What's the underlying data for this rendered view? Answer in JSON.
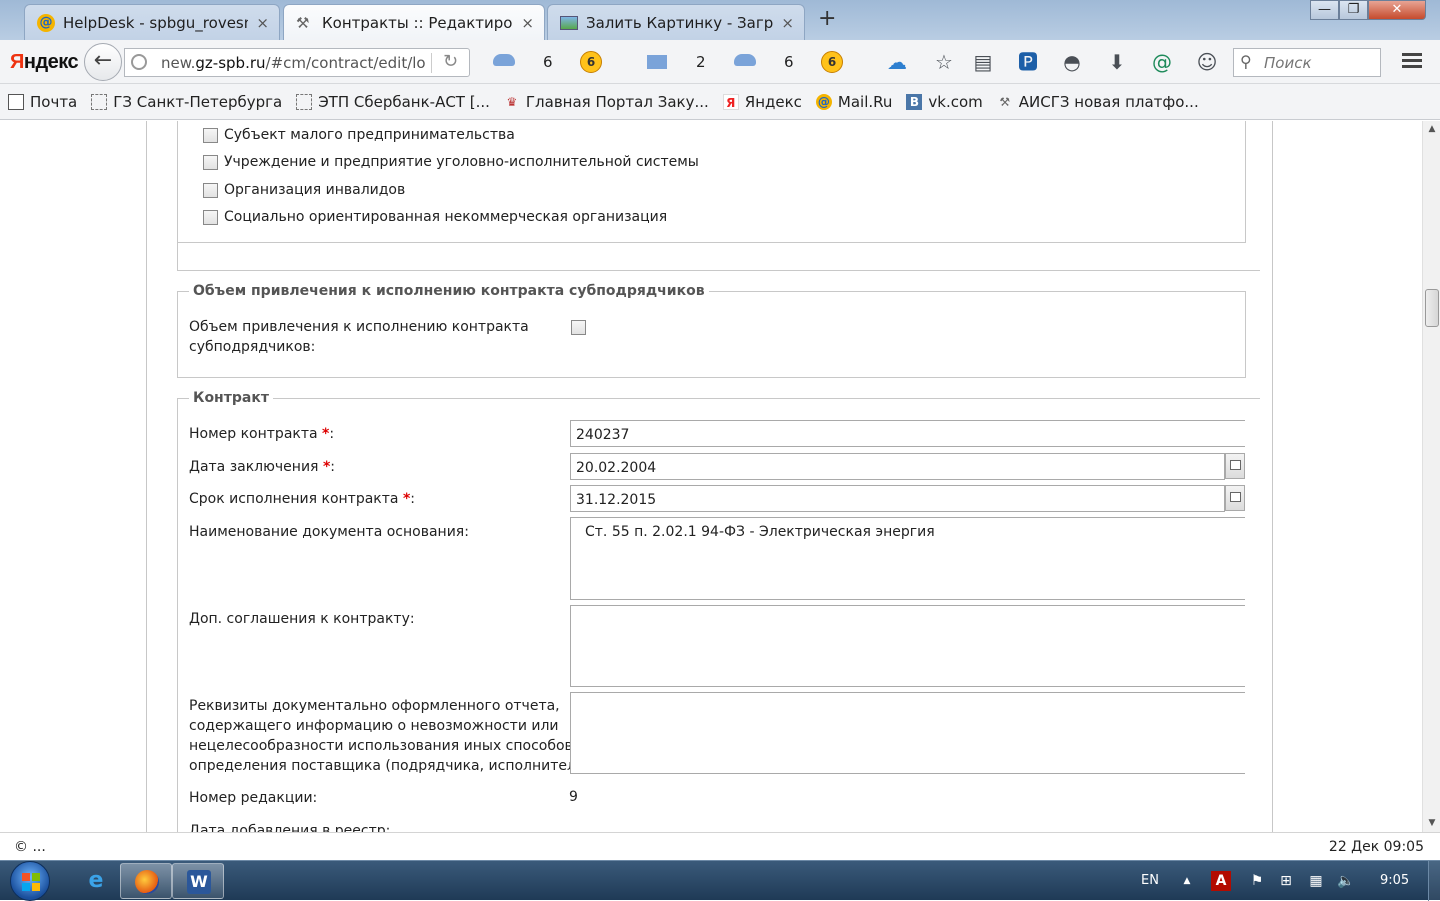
{
  "tabs": [
    {
      "label": "HelpDesk - spbgu_rovesnik...",
      "close": "×",
      "icon": "mailru-icon"
    },
    {
      "label": "Контракты :: Редактирова...",
      "close": "×",
      "icon": "tools-icon"
    },
    {
      "label": "Залить Картинку - Загруз...",
      "close": "×",
      "icon": "image-icon"
    }
  ],
  "new_tab": "+",
  "window_controls": {
    "minimize": "—",
    "maximize": "❐",
    "close": "✕"
  },
  "navbar": {
    "logo_red": "Я",
    "logo_rest": "ндекс",
    "url_prefix": "new.",
    "url_domain": "gz-spb.ru",
    "url_path": "/#cm/contract/edit/lo",
    "cloud_count_1": "6",
    "mail_count": "2",
    "cloud_count_2": "6",
    "coin_label": "6",
    "search_placeholder": "Поиск"
  },
  "bookmarks": [
    {
      "label": "Почта",
      "icon": "envelope"
    },
    {
      "label": "ГЗ Санкт-Петербурга",
      "icon": "dotted"
    },
    {
      "label": "ЭТП Сбербанк-АСТ [...",
      "icon": "dotted"
    },
    {
      "label": "Главная Портал Заку...",
      "icon": "eagle"
    },
    {
      "label": "Яндекс",
      "icon": "yandex"
    },
    {
      "label": "Mail.Ru",
      "icon": "mailru"
    },
    {
      "label": "vk.com",
      "icon": "vk"
    },
    {
      "label": "АИСГЗ новая платфо...",
      "icon": "tools"
    }
  ],
  "form": {
    "checkboxes": [
      "Субъект малого предпринимательства",
      "Учреждение и предприятие уголовно-исполнительной системы",
      "Организация инвалидов",
      "Социально ориентированная некоммерческая организация"
    ],
    "subcontract_section": {
      "legend": "Объем привлечения к исполнению контракта субподрядчиков",
      "label_line1": "Объем привлечения к исполнению контракта",
      "label_line2": "субподрядчиков:"
    },
    "contract_section": {
      "legend": "Контракт",
      "number_label": "Номер контракта ",
      "number_value": "240237",
      "date_label": "Дата заключения ",
      "date_value": "20.02.2004",
      "term_label": "Срок исполнения контракта ",
      "term_value": "31.12.2015",
      "basis_label": "Наименование документа основания:",
      "basis_value": "Ст. 55 п. 2.02.1 94-ФЗ - Электрическая энергия",
      "addendum_label": "Доп. соглашения к контракту:",
      "addendum_value": "",
      "report_label_1": "Реквизиты документально оформленного отчета,",
      "report_label_2": "содержащего информацию о невозможности или",
      "report_label_3": "нецелесообразности использования иных способов",
      "report_label_4": "определения поставщика (подрядчика, исполнителя):",
      "report_value": "",
      "revision_label": "Номер редакции:",
      "revision_value": "9",
      "added_label": "Дата добавления в реестр:",
      "required_mark": "*",
      "colon": ":"
    }
  },
  "statusbar": {
    "left": "© ...",
    "right": "22 Дек 09:05"
  },
  "taskbar": {
    "lang": "EN",
    "time": "9:05",
    "tray_arrow": "▲"
  }
}
